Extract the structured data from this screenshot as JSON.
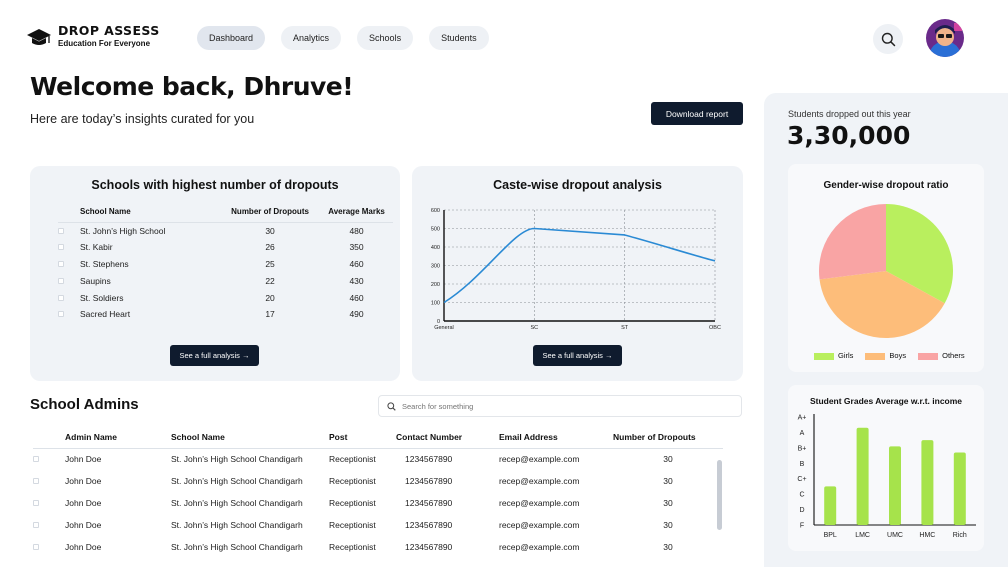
{
  "brand": {
    "name": "DROP ASSESS",
    "tagline": "Education For Everyone"
  },
  "nav": [
    "Dashboard",
    "Analytics",
    "Schools",
    "Students"
  ],
  "welcome": {
    "title": "Welcome back, Dhruve!",
    "subtitle": "Here are today’s insights curated for you"
  },
  "download_label": "Download report",
  "schools_card": {
    "title": "Schools with highest number of dropouts",
    "headers": [
      "School Name",
      "Number of Dropouts",
      "Average Marks"
    ],
    "rows": [
      [
        "St. John’s High School",
        "30",
        "480"
      ],
      [
        "St. Kabir",
        "26",
        "350"
      ],
      [
        "St. Stephens",
        "25",
        "460"
      ],
      [
        "Saupins",
        "22",
        "430"
      ],
      [
        "St. Soldiers",
        "20",
        "460"
      ],
      [
        "Sacred Heart",
        "17",
        "490"
      ]
    ],
    "button": "See a full analysis →"
  },
  "caste_card": {
    "title": "Caste-wise dropout analysis",
    "button": "See a full analysis →"
  },
  "students_dropped": {
    "label": "Students dropped out this year",
    "value": "3,30,000"
  },
  "admins": {
    "title": "School Admins",
    "search_placeholder": "Search for something",
    "headers": [
      "Admin Name",
      "School Name",
      "Post",
      "Contact Number",
      "Email Address",
      "Number of Dropouts"
    ],
    "rows": [
      [
        "John Doe",
        "St. John’s High School Chandigarh",
        "Receptionist",
        "1234567890",
        "recep@example.com",
        "30"
      ],
      [
        "John Doe",
        "St. John’s High School Chandigarh",
        "Receptionist",
        "1234567890",
        "recep@example.com",
        "30"
      ],
      [
        "John Doe",
        "St. John’s High School Chandigarh",
        "Receptionist",
        "1234567890",
        "recep@example.com",
        "30"
      ],
      [
        "John Doe",
        "St. John’s High School Chandigarh",
        "Receptionist",
        "1234567890",
        "recep@example.com",
        "30"
      ],
      [
        "John Doe",
        "St. John’s High School Chandigarh",
        "Receptionist",
        "1234567890",
        "recep@example.com",
        "30"
      ]
    ]
  },
  "icons": {
    "logo": "graduation-cap-icon",
    "search": "search-icon"
  },
  "colors": {
    "dark": "#0f1b2e",
    "line": "#2a8ad4",
    "girls": "#b9ef5e",
    "boys": "#fdbd7a",
    "others": "#f9a4a4",
    "bar": "#a6e34b",
    "panel": "#f0f3f7"
  },
  "chart_data": [
    {
      "type": "line",
      "title": "Caste-wise dropout analysis",
      "x": [
        "General",
        "SC",
        "ST",
        "OBC"
      ],
      "series": [
        {
          "values": [
            100,
            500,
            465,
            325
          ]
        }
      ],
      "yticks": [
        0,
        100,
        200,
        300,
        400,
        500,
        600
      ],
      "ylim": [
        0,
        600
      ],
      "grid": true
    },
    {
      "type": "pie",
      "title": "Gender-wise dropout ratio",
      "labels": [
        "Girls",
        "Boys",
        "Others"
      ],
      "values": [
        33,
        40,
        27
      ],
      "colors": [
        "#b9ef5e",
        "#fdbd7a",
        "#f9a4a4"
      ],
      "legend": "bottom"
    },
    {
      "type": "bar",
      "title": "Student Grades Average w.r.t. income",
      "categories": [
        "BPL",
        "LMC",
        "UMC",
        "HMC",
        "Rich"
      ],
      "values": [
        2.5,
        6.3,
        5.1,
        5.5,
        4.7
      ],
      "ytick_labels": [
        "F",
        "D",
        "C",
        "C+",
        "B",
        "B+",
        "A",
        "A+"
      ],
      "ylim": [
        0,
        7
      ]
    }
  ]
}
